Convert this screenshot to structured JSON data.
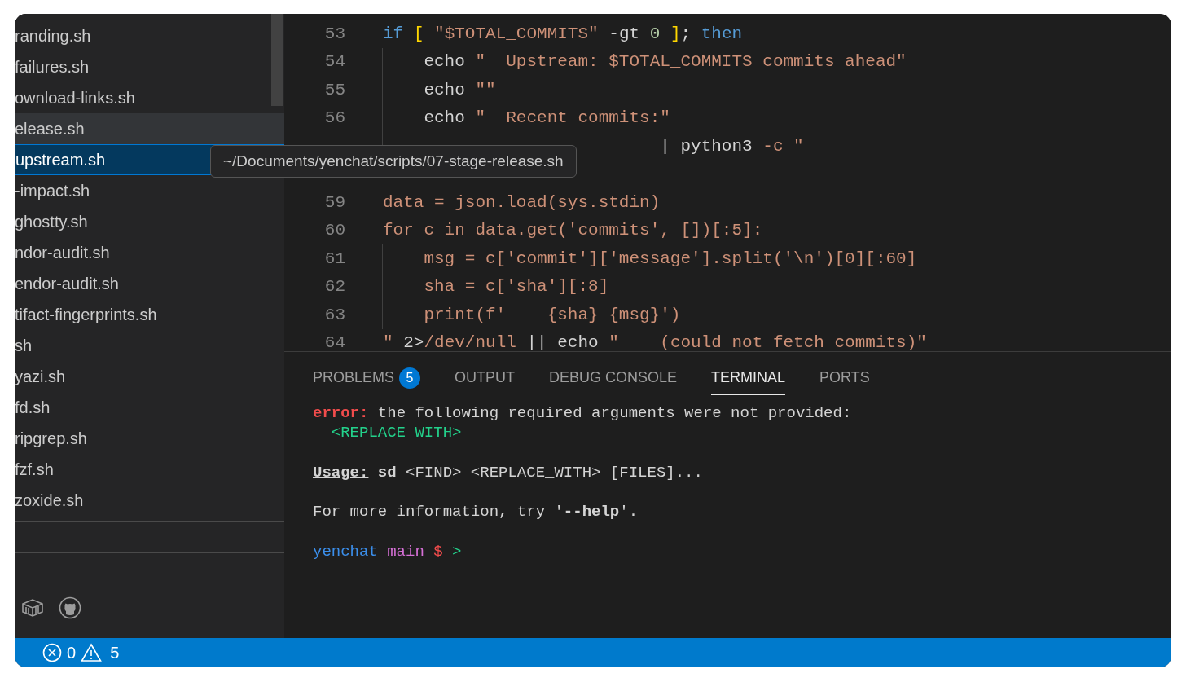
{
  "sidebar": {
    "items": [
      {
        "label": "randing.sh",
        "selected": false,
        "hovered": false
      },
      {
        "label": "failures.sh",
        "selected": false,
        "hovered": false
      },
      {
        "label": "ownload-links.sh",
        "selected": false,
        "hovered": false
      },
      {
        "label": "elease.sh",
        "selected": false,
        "hovered": true
      },
      {
        "label": "upstream.sh",
        "selected": true,
        "hovered": false
      },
      {
        "label": "-impact.sh",
        "selected": false,
        "hovered": false
      },
      {
        "label": "ghostty.sh",
        "selected": false,
        "hovered": false
      },
      {
        "label": "ndor-audit.sh",
        "selected": false,
        "hovered": false
      },
      {
        "label": "endor-audit.sh",
        "selected": false,
        "hovered": false
      },
      {
        "label": "tifact-fingerprints.sh",
        "selected": false,
        "hovered": false
      },
      {
        "label": "sh",
        "selected": false,
        "hovered": false
      },
      {
        "label": "yazi.sh",
        "selected": false,
        "hovered": false
      },
      {
        "label": "fd.sh",
        "selected": false,
        "hovered": false
      },
      {
        "label": "ripgrep.sh",
        "selected": false,
        "hovered": false
      },
      {
        "label": "fzf.sh",
        "selected": false,
        "hovered": false
      },
      {
        "label": "zoxide.sh",
        "selected": false,
        "hovered": false
      }
    ],
    "tooltip": "~/Documents/yenchat/scripts/07-stage-release.sh"
  },
  "editor": {
    "lines": [
      {
        "number": "53",
        "indent_guide": false,
        "segments": [
          {
            "text": "if ",
            "kind": "keyword"
          },
          {
            "text": "[ ",
            "kind": "bracket"
          },
          {
            "text": "\"$TOTAL_COMMITS\"",
            "kind": "string"
          },
          {
            "text": " -gt ",
            "kind": "plain"
          },
          {
            "text": "0 ",
            "kind": "number"
          },
          {
            "text": "]",
            "kind": "bracket"
          },
          {
            "text": "; ",
            "kind": "plain"
          },
          {
            "text": "then",
            "kind": "keyword"
          }
        ]
      },
      {
        "number": "54",
        "indent_guide": true,
        "segments": [
          {
            "text": "    echo ",
            "kind": "plain"
          },
          {
            "text": "\"  Upstream: $TOTAL_COMMITS commits ahead\"",
            "kind": "string"
          }
        ]
      },
      {
        "number": "55",
        "indent_guide": true,
        "segments": [
          {
            "text": "    echo ",
            "kind": "plain"
          },
          {
            "text": "\"\"",
            "kind": "string"
          }
        ]
      },
      {
        "number": "56",
        "indent_guide": true,
        "segments": [
          {
            "text": "    echo ",
            "kind": "plain"
          },
          {
            "text": "\"  Recent commits:\"",
            "kind": "string"
          }
        ]
      },
      {
        "indent_guide": true,
        "segments": [
          {
            "text": "                           | python3 ",
            "kind": "plain"
          },
          {
            "text": "-c \"",
            "kind": "string"
          }
        ]
      },
      {
        "number": "59",
        "indent_guide": false,
        "blank_before": true,
        "segments": [
          {
            "text": "data = json.load(sys.stdin)",
            "kind": "string"
          }
        ]
      },
      {
        "number": "60",
        "indent_guide": false,
        "segments": [
          {
            "text": "for c in data.get('commits', [])[:5]:",
            "kind": "string"
          }
        ]
      },
      {
        "number": "61",
        "indent_guide": true,
        "segments": [
          {
            "text": "    msg = c['commit']['message'].split('\\n')[0][:60]",
            "kind": "string"
          }
        ]
      },
      {
        "number": "62",
        "indent_guide": true,
        "segments": [
          {
            "text": "    sha = c['sha'][:8]",
            "kind": "string"
          }
        ]
      },
      {
        "number": "63",
        "indent_guide": true,
        "segments": [
          {
            "text": "    print(f'    {sha} {msg}')",
            "kind": "string"
          }
        ]
      },
      {
        "number": "64",
        "indent_guide": false,
        "segments": [
          {
            "text": "\"",
            "kind": "string"
          },
          {
            "text": " 2>",
            "kind": "plain"
          },
          {
            "text": "/dev/null",
            "kind": "string"
          },
          {
            "text": " || echo ",
            "kind": "plain"
          },
          {
            "text": "\"    (could not fetch commits)\"",
            "kind": "string"
          }
        ]
      }
    ]
  },
  "panel": {
    "tabs": [
      {
        "label": "PROBLEMS",
        "selected": false,
        "badge": "5"
      },
      {
        "label": "OUTPUT",
        "selected": false
      },
      {
        "label": "DEBUG CONSOLE",
        "selected": false
      },
      {
        "label": "TERMINAL",
        "selected": true
      },
      {
        "label": "PORTS",
        "selected": false
      }
    ],
    "terminal_blocks": [
      [
        [
          {
            "text": "error:",
            "kind": "error"
          },
          {
            "text": " the following required arguments were not provided:",
            "kind": "plain"
          }
        ],
        [
          {
            "text": "  <REPLACE_WITH>",
            "kind": "green"
          }
        ]
      ],
      [
        [
          {
            "text": "Usage:",
            "kind": "heading"
          },
          {
            "text": " sd",
            "kind": "bold"
          },
          {
            "text": " <FIND> <REPLACE_WITH> [FILES]...",
            "kind": "plain"
          }
        ]
      ],
      [
        [
          {
            "text": "For more information, try '",
            "kind": "plain"
          },
          {
            "text": "--help",
            "kind": "bold"
          },
          {
            "text": "'.",
            "kind": "plain"
          }
        ]
      ],
      [
        [
          {
            "text": "yenchat ",
            "kind": "blue"
          },
          {
            "text": "main ",
            "kind": "magenta"
          },
          {
            "text": "$ ",
            "kind": "red"
          },
          {
            "text": ">",
            "kind": "green"
          }
        ]
      ]
    ]
  },
  "status_bar": {
    "errors": "0",
    "warnings": "5"
  }
}
